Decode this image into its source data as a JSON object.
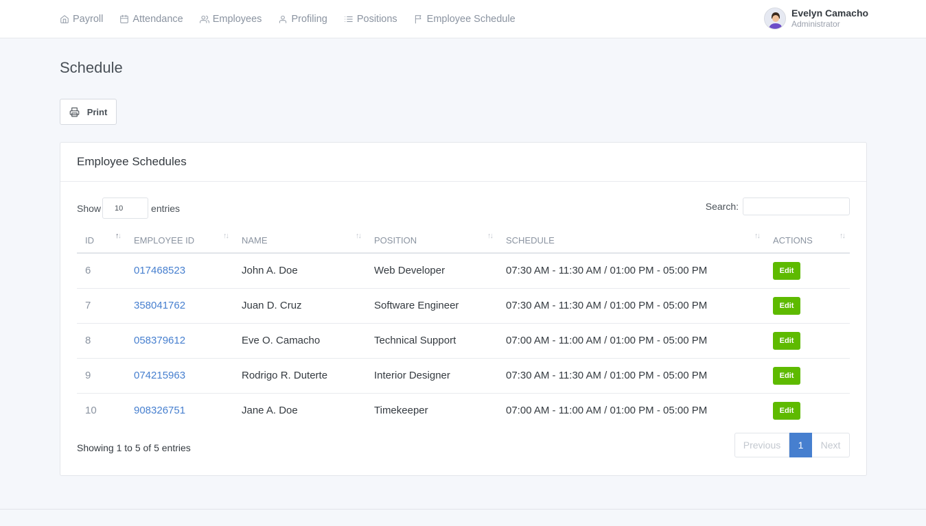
{
  "nav": [
    {
      "label": "Payroll",
      "icon": "home-icon"
    },
    {
      "label": "Attendance",
      "icon": "calendar-icon"
    },
    {
      "label": "Employees",
      "icon": "users-icon"
    },
    {
      "label": "Profiling",
      "icon": "user-icon"
    },
    {
      "label": "Positions",
      "icon": "list-icon"
    },
    {
      "label": "Employee Schedule",
      "icon": "flag-icon"
    }
  ],
  "user": {
    "name": "Evelyn Camacho",
    "role": "Administrator"
  },
  "page_title": "Schedule",
  "print_label": "Print",
  "card": {
    "title": "Employee Schedules",
    "show_label": "Show",
    "entries_value": "10",
    "entries_label": "entries",
    "search_label": "Search:",
    "columns": [
      "ID",
      "EMPLOYEE ID",
      "NAME",
      "POSITION",
      "SCHEDULE",
      "ACTIONS"
    ],
    "rows": [
      {
        "id": "6",
        "employee_id": "017468523",
        "name": "John A. Doe",
        "position": "Web Developer",
        "schedule": "07:30 AM - 11:30 AM / 01:00 PM - 05:00 PM",
        "action": "Edit"
      },
      {
        "id": "7",
        "employee_id": "358041762",
        "name": "Juan D. Cruz",
        "position": "Software Engineer",
        "schedule": "07:30 AM - 11:30 AM / 01:00 PM - 05:00 PM",
        "action": "Edit"
      },
      {
        "id": "8",
        "employee_id": "058379612",
        "name": "Eve O. Camacho",
        "position": "Technical Support",
        "schedule": "07:00 AM - 11:00 AM / 01:00 PM - 05:00 PM",
        "action": "Edit"
      },
      {
        "id": "9",
        "employee_id": "074215963",
        "name": "Rodrigo R. Duterte",
        "position": "Interior Designer",
        "schedule": "07:30 AM - 11:30 AM / 01:00 PM - 05:00 PM",
        "action": "Edit"
      },
      {
        "id": "10",
        "employee_id": "908326751",
        "name": "Jane A. Doe",
        "position": "Timekeeper",
        "schedule": "07:00 AM - 11:00 AM / 01:00 PM - 05:00 PM",
        "action": "Edit"
      }
    ],
    "info": "Showing 1 to 5 of 5 entries",
    "pagination": {
      "previous": "Previous",
      "current": "1",
      "next": "Next"
    }
  },
  "colors": {
    "accent": "#467fcf",
    "edit": "#5eba00",
    "background": "#f5f7fb"
  }
}
